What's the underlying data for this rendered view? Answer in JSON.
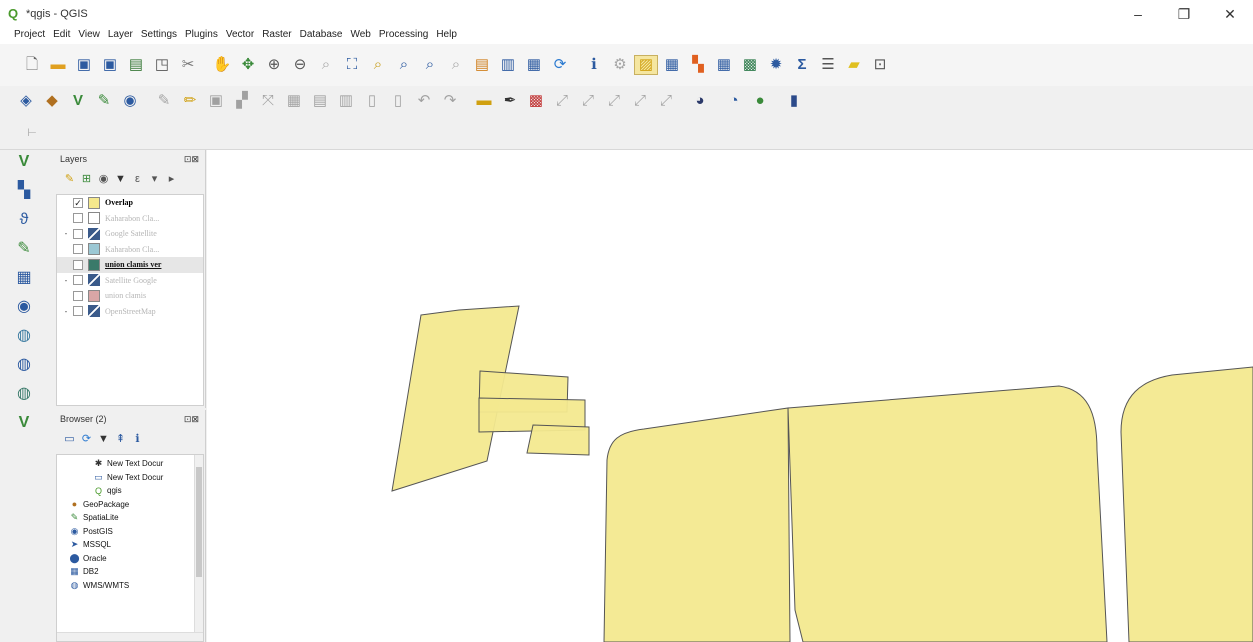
{
  "window": {
    "title": "*qgis - QGIS",
    "app_icon": "qgis-icon"
  },
  "menu": [
    "Project",
    "Edit",
    "View",
    "Layer",
    "Settings",
    "Plugins",
    "Vector",
    "Raster",
    "Database",
    "Web",
    "Processing",
    "Help"
  ],
  "layers_panel": {
    "title": "Layers",
    "layers": [
      {
        "name": "Overlap",
        "checked": true,
        "expander": "",
        "style": "active",
        "color": "#f5e88c"
      },
      {
        "name": "Kaharabon Cla...",
        "checked": false,
        "expander": "",
        "style": "dim",
        "color": "#ffffff"
      },
      {
        "name": "Google Satellite",
        "checked": false,
        "expander": "-",
        "style": "dim",
        "color": "raster"
      },
      {
        "name": "Kaharabon Cla...",
        "checked": false,
        "expander": "",
        "style": "dim",
        "color": "#9cc8d4"
      },
      {
        "name": "union clamis ver",
        "checked": false,
        "expander": "",
        "style": "ul",
        "color": "#3a7a6a"
      },
      {
        "name": "Satellite Google",
        "checked": false,
        "expander": "-",
        "style": "dim",
        "color": "raster"
      },
      {
        "name": "union clamis",
        "checked": false,
        "expander": "",
        "style": "dim",
        "color": "#d9a6a6"
      },
      {
        "name": "OpenStreetMap",
        "checked": false,
        "expander": "-",
        "style": "dim",
        "color": "raster"
      }
    ]
  },
  "browser_panel": {
    "title": "Browser (2)",
    "items": [
      {
        "icon": "xyz-icon",
        "glyph": "✱",
        "label": "New Text Docur"
      },
      {
        "icon": "text-file-icon",
        "glyph": "▭",
        "label": "New Text Docur"
      },
      {
        "icon": "qgis-project-icon",
        "glyph": "Q",
        "label": "qgis"
      },
      {
        "icon": "geopackage-icon",
        "glyph": "●",
        "label": "GeoPackage"
      },
      {
        "icon": "spatialite-icon",
        "glyph": "✎",
        "label": "SpatiaLite"
      },
      {
        "icon": "postgis-icon",
        "glyph": "◉",
        "label": "PostGIS"
      },
      {
        "icon": "mssql-icon",
        "glyph": "➤",
        "label": "MSSQL"
      },
      {
        "icon": "oracle-icon",
        "glyph": "⬤",
        "label": "Oracle"
      },
      {
        "icon": "db2-icon",
        "glyph": "▦",
        "label": "DB2"
      },
      {
        "icon": "wms-icon",
        "glyph": "◍",
        "label": "WMS/WMTS"
      }
    ]
  },
  "map": {
    "fill_color": "#f3e98f",
    "stroke_color": "#555555",
    "background": "#ffffff"
  }
}
